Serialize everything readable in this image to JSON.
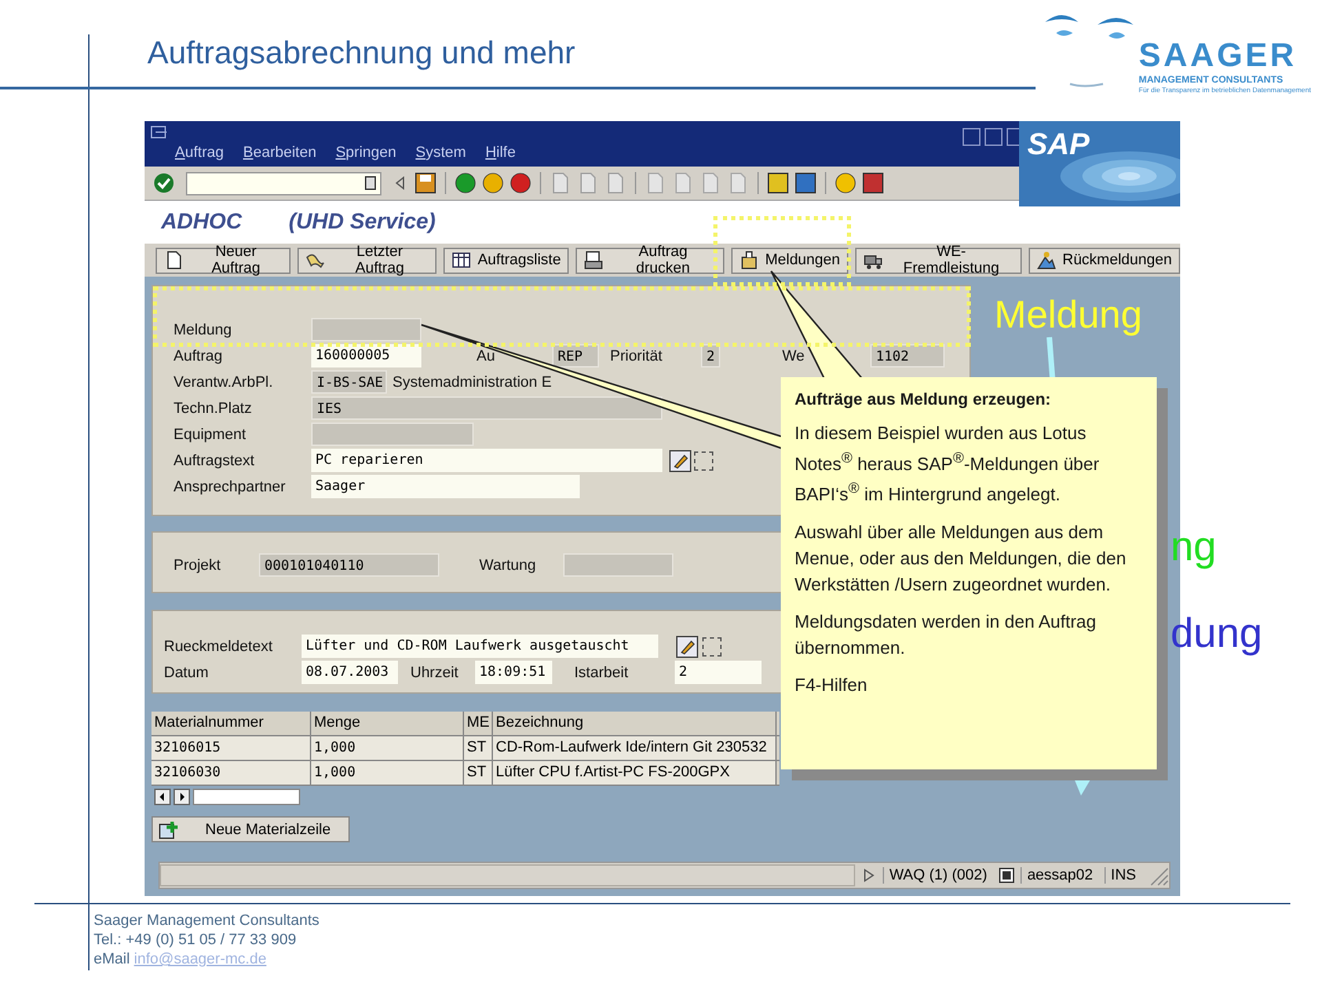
{
  "slide": {
    "title": "Auftragsabrechnung und mehr"
  },
  "logo": {
    "name": "SAAGER",
    "subtitle": "MANAGEMENT CONSULTANTS",
    "tagline": "Für die Transparenz im betrieblichen Datenmanagement"
  },
  "sap": {
    "menu": [
      "Auftrag",
      "Bearbeiten",
      "Springen",
      "System",
      "Hilfe"
    ],
    "logo": "SAP",
    "title": [
      "ADHOC",
      "(UHD Service)"
    ],
    "buttons": [
      "Neuer Auftrag",
      "Letzter Auftrag",
      "Auftragsliste",
      "Auftrag drucken",
      "Meldungen",
      "WE-Fremdleistung",
      "Rückmeldungen"
    ],
    "order_panel": [
      [
        {
          "kind": "label",
          "text": "Meldung"
        },
        {
          "kind": "field",
          "readonly": true
        }
      ],
      [
        {
          "kind": "label",
          "text": "Auftrag"
        },
        {
          "kind": "field",
          "value": "160000005",
          "readonly": false
        },
        {
          "kind": "label",
          "text": "Au"
        },
        {
          "kind": "field",
          "value": "REP",
          "readonly": true
        },
        {
          "kind": "label",
          "text": "Priorität"
        },
        {
          "kind": "field",
          "value": "2",
          "readonly": true
        },
        {
          "kind": "label",
          "text": "We"
        },
        {
          "kind": "field",
          "value": "1102",
          "readonly": true
        }
      ],
      [
        {
          "kind": "label",
          "text": "Verantw.ArbPl."
        },
        {
          "kind": "field",
          "value": "I-BS-SAE",
          "readonly": true
        },
        {
          "kind": "label",
          "text": "Systemadministration E"
        }
      ],
      [
        {
          "kind": "label",
          "text": "Techn.Platz"
        },
        {
          "kind": "field",
          "value": "IES",
          "readonly": true
        }
      ],
      [
        {
          "kind": "label",
          "text": "Equipment"
        },
        {
          "kind": "field",
          "readonly": true
        }
      ],
      [
        {
          "kind": "label",
          "text": "Auftragstext"
        },
        {
          "kind": "field",
          "value": "PC reparieren",
          "readonly": false
        },
        {
          "kind": "edit"
        },
        {
          "kind": "box",
          "checked": false
        }
      ],
      [
        {
          "kind": "label",
          "text": "Ansprechpartner"
        },
        {
          "kind": "field",
          "value": "Saager",
          "readonly": false
        }
      ]
    ],
    "project_panel": [
      [
        {
          "kind": "label",
          "text": "Projekt"
        },
        {
          "kind": "field",
          "value": "000101040110",
          "readonly": true
        },
        {
          "kind": "label",
          "text": "Wartung"
        },
        {
          "kind": "field",
          "readonly": true
        }
      ]
    ],
    "confirmation_panel": [
      [
        {
          "kind": "label",
          "text": "Rueckmeldetext"
        },
        {
          "kind": "field",
          "value": "Lüfter und CD-ROM Laufwerk ausgetauscht",
          "readonly": false
        },
        {
          "kind": "edit"
        },
        {
          "kind": "box",
          "checked": false
        }
      ],
      [
        {
          "kind": "label",
          "text": "Datum"
        },
        {
          "kind": "field",
          "value": "08.07.2003",
          "readonly": false
        },
        {
          "kind": "label",
          "text": "Uhrzeit"
        },
        {
          "kind": "field",
          "value": "18:09:51",
          "readonly": false
        },
        {
          "kind": "label",
          "text": "Istarbeit"
        },
        {
          "kind": "field",
          "value": "2",
          "readonly": false
        }
      ]
    ],
    "materials": {
      "columns": [
        "Materialnummer",
        "Menge",
        "ME",
        "Bezeichnung"
      ],
      "rows": [
        [
          "32106015",
          "1,000",
          "ST",
          "CD-Rom-Laufwerk Ide/intern Git 230532"
        ],
        [
          "32106030",
          "1,000",
          "ST",
          "Lüfter CPU f.Artist-PC FS-200GPX"
        ]
      ]
    },
    "new_row_button": "Neue Materialzeile",
    "status_bar": {
      "system": "WAQ (1) (002)",
      "server": "aessap02",
      "mode": "INS"
    }
  },
  "callout": {
    "title": "Aufträge aus Meldung erzeugen:",
    "paragraphs": [
      "In diesem Beispiel wurden aus Lotus Notes$^{®}$ heraus SAP$^{®}$-Meldungen über BAPI‘s$^{®}$ im Hintergrund angelegt.",
      "Auswahl über alle Meldungen aus dem Menue, oder aus den Meldungen, die den Werkstätten /Usern zugeordnet wurden.",
      "Meldungsdaten werden in den Auftrag übernommen.",
      "F4-Hilfen"
    ]
  },
  "annotations": [
    {
      "text": "Meldung",
      "color": "#ffff33"
    },
    {
      "text": "ng",
      "color": "#22dd22"
    },
    {
      "text": "dung",
      "color": "#3333cc"
    }
  ],
  "footer": {
    "company": "Saager Management Consultants",
    "phone": "Tel.: +49 (0) 51 05 / 77 33 909",
    "email_label": "eMail",
    "email": "info@saager-mc.de"
  }
}
